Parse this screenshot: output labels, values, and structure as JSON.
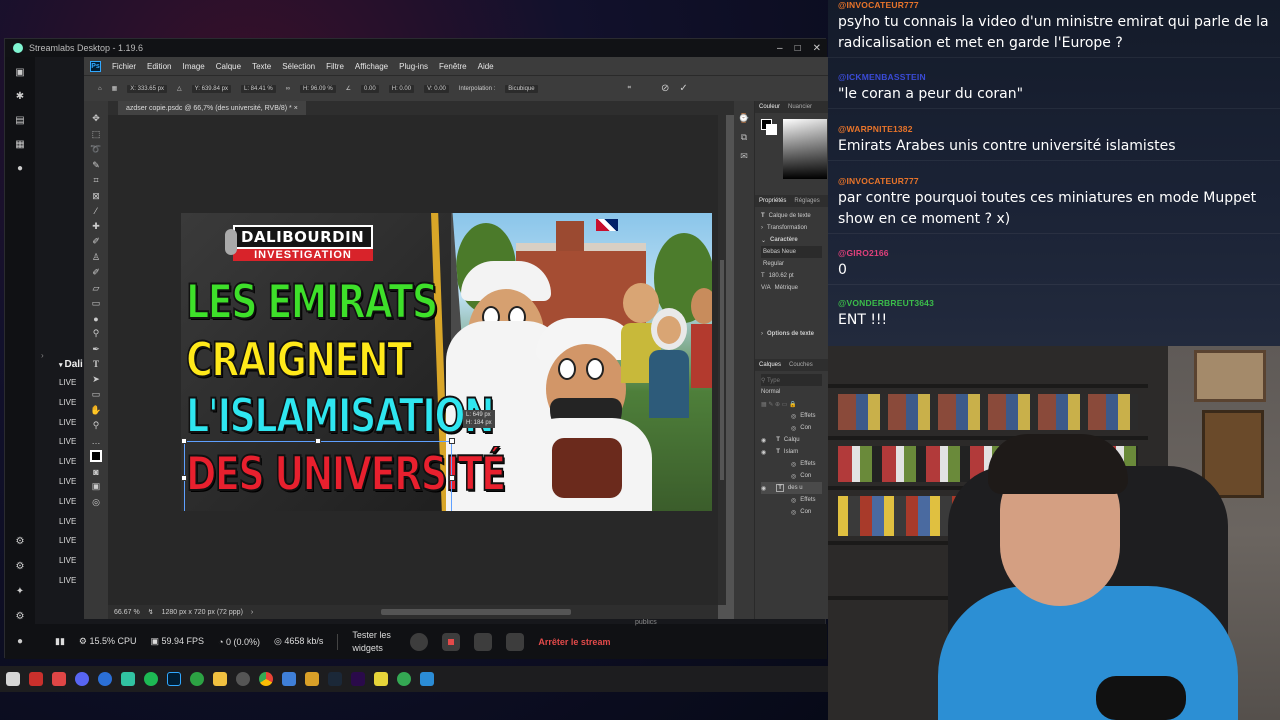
{
  "streamlabs": {
    "title": "Streamlabs Desktop - 1.19.6",
    "dock_title": "Dali",
    "dock_items": [
      "LIVE",
      "LIVE",
      "LIVE",
      "LIVE",
      "LIVE",
      "LIVE",
      "LIVE",
      "LIVE",
      "LIVE",
      "LIVE",
      "LIVE"
    ],
    "cpu": "15.5% CPU",
    "fps": "59.94 FPS",
    "dropped": "0 (0.0%)",
    "bitrate": "4658 kb/s",
    "test_widgets": "Tester les widgets",
    "stop_stream": "Arrêter le stream",
    "publics": "publics"
  },
  "photoshop": {
    "menu": [
      "Fichier",
      "Edition",
      "Image",
      "Calque",
      "Texte",
      "Sélection",
      "Filtre",
      "Affichage",
      "Plug-ins",
      "Fenêtre",
      "Aide"
    ],
    "options": {
      "x": "X: 333.65 px",
      "y": "Y: 639.84 px",
      "w": "L: 84.41 %",
      "h": "H: 96.09 %",
      "angle": "0.00",
      "hs": "H: 0.00",
      "vs": "V: 0.00",
      "interp_label": "Interpolation :",
      "interp_value": "Bicubique"
    },
    "tab": "azdser copie.psdc @ 66,7% (des université, RVB/8) *",
    "zoom": "66.67 %",
    "doc_info": "1280 px x 720 px (72 ppp)",
    "transform_tip": [
      "L: 649 px",
      "H: 184 px"
    ],
    "panel": {
      "tab_color": "Couleur",
      "tab_swatch": "Nuancier",
      "tab_props": "Propriétés",
      "tab_adjust": "Réglages",
      "layer_kind": "Calque de texte",
      "transform": "Transformation",
      "character": "Caractère",
      "font": "Bebas Neue",
      "style": "Regular",
      "size": "180.62 pt",
      "kerning": "Métrique",
      "text_options": "Options de texte",
      "layers": "Calques",
      "channels": "Couches",
      "blend": "Normal",
      "layer_rows": [
        "Calqu",
        "Effets",
        "Con",
        "Islam",
        "Effets",
        "Con",
        "des u",
        "Effets",
        "Con"
      ]
    }
  },
  "thumbnail": {
    "logo_top": "DALIBOURDIN",
    "logo_bottom": "INVESTIGATION",
    "line1": "LES EMIRATS",
    "line2": "CRAIGNENT",
    "line3": "L'ISLAMISATION",
    "line4": "DES UNIVERSITÉ",
    "colors": {
      "line1": "#3ee02a",
      "line2": "#ffe91a",
      "line3": "#2fe6f0",
      "line4": "#e8202e"
    }
  },
  "chat": [
    {
      "user": "@INVOCATEUR777",
      "color": "#e8742a",
      "text": "psyho tu connais la video d'un ministre emirat qui parle de la radicalisation et met en garde l'Europe ?"
    },
    {
      "user": "@ICKMENBASSTEIN",
      "color": "#3a4bd6",
      "text": "\"le coran a peur du coran\""
    },
    {
      "user": "@WARPNITE1382",
      "color": "#e8742a",
      "text": "Emirats Arabes unis contre université islamistes"
    },
    {
      "user": "@INVOCATEUR777",
      "color": "#e8742a",
      "text": "par contre pourquoi toutes ces miniatures en mode Muppet show en ce moment ? x)"
    },
    {
      "user": "@GIRO2166",
      "color": "#e0407a",
      "text": "0"
    },
    {
      "user": "@VONDERBREUT3643",
      "color": "#3bbd4a",
      "text": "ENT !!!"
    }
  ]
}
